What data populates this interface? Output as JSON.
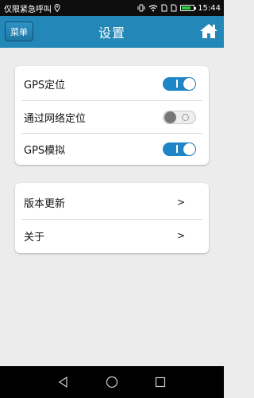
{
  "status_bar": {
    "carrier_text": "仅限紧急呼叫",
    "time": "15:44",
    "icons": [
      "location-icon",
      "vibrate-icon",
      "wifi-icon",
      "sim-icon",
      "sim-icon",
      "battery-icon"
    ]
  },
  "header": {
    "menu_label": "菜单",
    "title": "设置",
    "home_icon": "home-icon",
    "color": "#2387b8"
  },
  "settings_card": {
    "items": [
      {
        "label": "GPS定位",
        "toggle": "on"
      },
      {
        "label": "通过网络定位",
        "toggle": "off"
      },
      {
        "label": "GPS模拟",
        "toggle": "on"
      }
    ]
  },
  "info_card": {
    "items": [
      {
        "label": "版本更新",
        "chevron": ">"
      },
      {
        "label": "关于",
        "chevron": ">"
      }
    ]
  },
  "nav_bar": {
    "icons": [
      "back-icon",
      "home-circle-icon",
      "recents-icon"
    ]
  },
  "colors": {
    "accent": "#1e86c6",
    "background": "#ececec"
  }
}
